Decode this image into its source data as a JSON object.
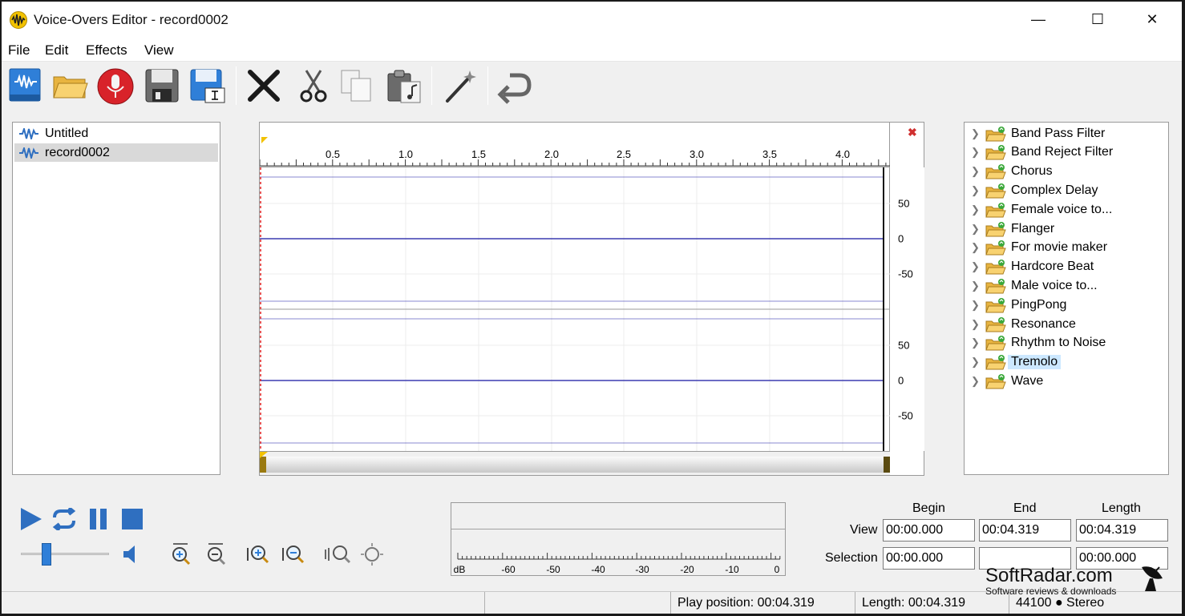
{
  "window": {
    "title": "Voice-Overs Editor - record0002",
    "minimize_glyph": "—",
    "maximize_glyph": "☐",
    "close_glyph": "✕"
  },
  "menu": [
    "File",
    "Edit",
    "Effects",
    "View"
  ],
  "toolbar": [
    {
      "name": "new-file-icon"
    },
    {
      "name": "open-folder-icon"
    },
    {
      "name": "record-microphone-icon"
    },
    {
      "name": "save-icon"
    },
    {
      "name": "save-as-icon"
    },
    {
      "name": "delete-icon"
    },
    {
      "name": "cut-icon"
    },
    {
      "name": "copy-icon"
    },
    {
      "name": "paste-icon"
    },
    {
      "name": "magic-wand-icon"
    },
    {
      "name": "undo-icon"
    }
  ],
  "files": [
    {
      "label": "Untitled",
      "selected": false
    },
    {
      "label": "record0002",
      "selected": true
    }
  ],
  "editor": {
    "ruler_labels": [
      "0.5",
      "1.0",
      "1.5",
      "2.0",
      "2.5",
      "3.0",
      "3.5",
      "4.0"
    ],
    "scale_labels": [
      "50",
      "0",
      "-50",
      "50",
      "0",
      "-50"
    ],
    "close_glyph": "✖",
    "wave_color": "#3b3bb0"
  },
  "effects": [
    {
      "label": "Band Pass Filter",
      "selected": false
    },
    {
      "label": "Band Reject Filter",
      "selected": false
    },
    {
      "label": "Chorus",
      "selected": false
    },
    {
      "label": "Complex Delay",
      "selected": false
    },
    {
      "label": "Female voice to...",
      "selected": false
    },
    {
      "label": "Flanger",
      "selected": false
    },
    {
      "label": "For movie maker",
      "selected": false
    },
    {
      "label": "Hardcore Beat",
      "selected": false
    },
    {
      "label": "Male voice to...",
      "selected": false
    },
    {
      "label": "PingPong",
      "selected": false
    },
    {
      "label": "Resonance",
      "selected": false
    },
    {
      "label": "Rhythm to Noise",
      "selected": false
    },
    {
      "label": "Tremolo",
      "selected": true
    },
    {
      "label": "Wave",
      "selected": false
    }
  ],
  "transport": {
    "volume_level": 0.27,
    "accent": "#2f6fc0"
  },
  "meter": {
    "labels": [
      "dB",
      "-60",
      "-50",
      "-40",
      "-30",
      "-20",
      "-10",
      "0"
    ]
  },
  "times": {
    "col_begin": "Begin",
    "col_end": "End",
    "col_length": "Length",
    "row_view": "View",
    "row_selection": "Selection",
    "view_begin": "00:00.000",
    "view_end": "00:04.319",
    "view_length": "00:04.319",
    "sel_begin": "00:00.000",
    "sel_end": "",
    "sel_length": "00:00.000"
  },
  "status": {
    "play_position": "Play position: 00:04.319",
    "length": "Length: 00:04.319",
    "format": "44100 ● Stereo"
  },
  "watermark": {
    "title": "SoftRadar.com",
    "subtitle": "Software reviews & downloads"
  }
}
